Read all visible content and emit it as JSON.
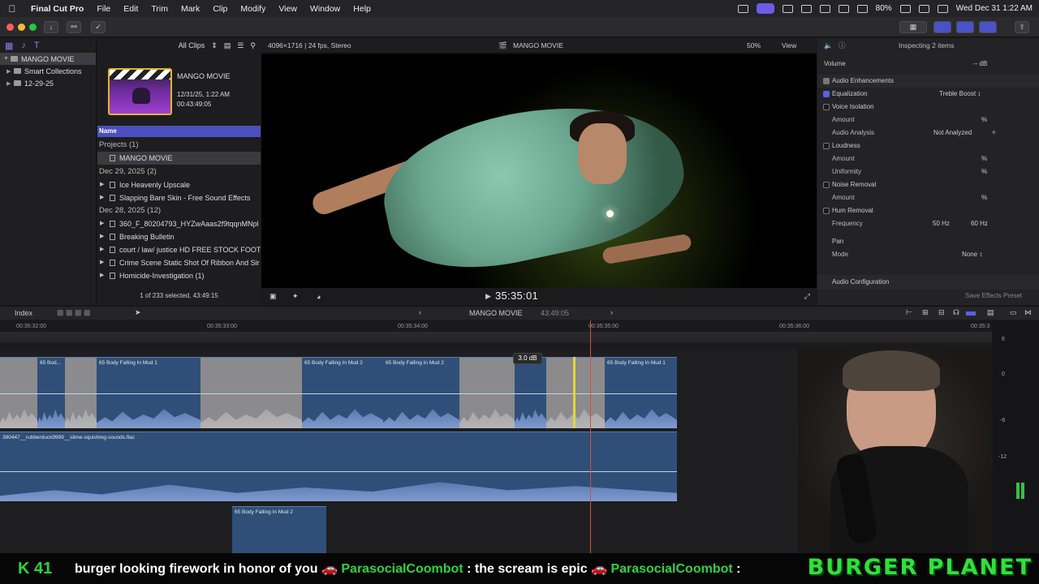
{
  "menubar": {
    "app": "Final Cut Pro",
    "items": [
      "File",
      "Edit",
      "Trim",
      "Mark",
      "Clip",
      "Modify",
      "View",
      "Window",
      "Help"
    ],
    "battery": "80%",
    "clock": "Wed Dec 31  1:22 AM"
  },
  "library": {
    "items": [
      {
        "label": "MANGO MOVIE",
        "selected": true
      },
      {
        "label": "Smart Collections",
        "selected": false
      },
      {
        "label": "12-29-25",
        "selected": false
      }
    ]
  },
  "browser": {
    "filter": "All Clips",
    "project_name": "MANGO MOVIE",
    "project_date": "12/31/25, 1:22 AM",
    "project_duration": "00:43:49:05",
    "column_name": "Name",
    "rows": [
      {
        "label": "Projects  (1)",
        "type": "header"
      },
      {
        "label": "MANGO MOVIE",
        "type": "project",
        "selected": true
      },
      {
        "label": "Dec 29, 2025  (2)",
        "type": "header"
      },
      {
        "label": "Ice Heavenly Upscale",
        "type": "audio"
      },
      {
        "label": "Slapping Bare Skin - Free Sound Effects",
        "type": "audio"
      },
      {
        "label": "Dec 28, 2025  (12)",
        "type": "header"
      },
      {
        "label": "360_F_80204793_HYZwAaas2f9tqqnMNpl",
        "type": "video"
      },
      {
        "label": "Breaking Bulletin",
        "type": "audio"
      },
      {
        "label": "court / law/ justice HD FREE STOCK FOOTA",
        "type": "video"
      },
      {
        "label": "Crime Scene Static Shot Of Ribbon And Sir",
        "type": "video"
      },
      {
        "label": "Homicide-Investigation (1)",
        "type": "video"
      }
    ],
    "footer": "1 of 233 selected, 43:49:15"
  },
  "viewer": {
    "format": "4096×1716 | 24 fps, Stereo",
    "title": "MANGO MOVIE",
    "zoom": "50%",
    "view_label": "View",
    "timecode": "35:35:01"
  },
  "inspector": {
    "header": "Inspecting 2 items",
    "rows": [
      {
        "label": "Volume",
        "value": "-- dB",
        "kind": "plain"
      },
      {
        "label": "Audio Enhancements",
        "kind": "section"
      },
      {
        "label": "Equalization",
        "value": "Treble Boost ↕",
        "kind": "check",
        "checked": true
      },
      {
        "label": "Voice Isolation",
        "kind": "check",
        "checked": false
      },
      {
        "label": "Amount",
        "value": "%",
        "kind": "sub"
      },
      {
        "label": "Audio Analysis",
        "value": "Not Analyzed",
        "kind": "sub"
      },
      {
        "label": "Loudness",
        "kind": "check",
        "checked": false
      },
      {
        "label": "Amount",
        "value": "%",
        "kind": "sub"
      },
      {
        "label": "Uniformity",
        "value": "%",
        "kind": "sub"
      },
      {
        "label": "Noise Removal",
        "kind": "check",
        "checked": false
      },
      {
        "label": "Amount",
        "value": "%",
        "kind": "sub"
      },
      {
        "label": "Hum Removal",
        "kind": "check",
        "checked": false
      },
      {
        "label": "Frequency",
        "value": "50 Hz",
        "value2": "60 Hz",
        "kind": "sub"
      },
      {
        "label": "Pan",
        "kind": "plain"
      },
      {
        "label": "Mode",
        "value": "None ↕",
        "kind": "sub"
      }
    ],
    "footer_left": "Audio Configuration",
    "footer_right": "Save Effects Preset"
  },
  "timeline": {
    "index_label": "Index",
    "project": "MANGO MOVIE",
    "duration": "43:49:05",
    "ruler": [
      "00:35:32:00",
      "00:35:33:00",
      "00:35:34:00",
      "00:35:35:00",
      "00:35:36:00",
      "00:35:3"
    ],
    "db_badge": "3.0 dB",
    "clips": [
      {
        "label": "",
        "grey": true
      },
      {
        "label": "65 Bod...",
        "grey": false
      },
      {
        "label": "",
        "grey": true
      },
      {
        "label": "65 Body Falling In Mud 1",
        "grey": false
      },
      {
        "label": "",
        "grey": true
      },
      {
        "label": "65 Body Falling In Mud 2",
        "grey": false
      },
      {
        "label": "65 Body Falling In Mud 2",
        "grey": false
      },
      {
        "label": "",
        "grey": true
      },
      {
        "label": "",
        "grey": false
      },
      {
        "label": "",
        "grey": true
      },
      {
        "label": "65 Body Falling In Mud 1",
        "grey": false
      }
    ],
    "long_clip": "380447__rubberduck9999__slime-squishing-sounds.flac",
    "lower_clip": "65 Body Falling In Mud 2",
    "meter_labels": [
      "6",
      "0",
      "-6",
      "-12"
    ]
  },
  "stream": {
    "k_badge": "K 41",
    "ticker_parts": [
      {
        "text": "burger looking firework in honor of you  ",
        "hl": false
      },
      {
        "text": "ParasocialCoombot",
        "hl": true
      },
      {
        "text": " : the scream is epic  ",
        "hl": false
      },
      {
        "text": "ParasocialCoombot",
        "hl": true
      },
      {
        "text": " :",
        "hl": false
      }
    ],
    "banner": "BURGER  PLANET"
  }
}
